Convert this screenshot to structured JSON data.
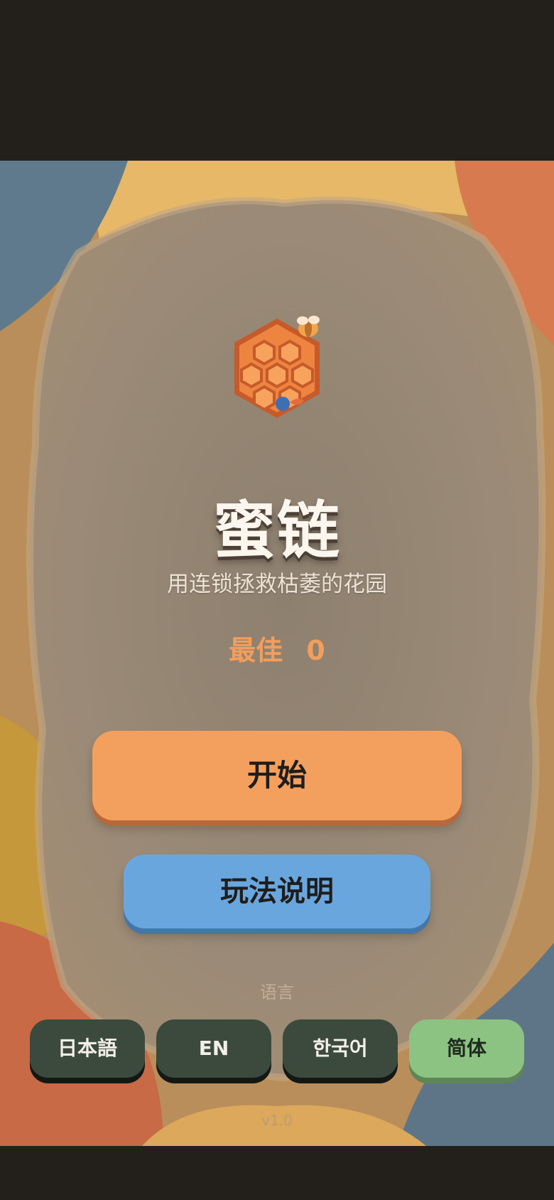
{
  "game": {
    "title": "蜜链",
    "subtitle": "用连锁拯救枯萎的花园",
    "best_label": "最佳",
    "best_value": "0",
    "start_label": "开始",
    "howto_label": "玩法说明",
    "language_label": "语言",
    "version": "v1.0"
  },
  "languages": [
    {
      "label": "日本語",
      "active": false
    },
    {
      "label": "EN",
      "active": false
    },
    {
      "label": "한국어",
      "active": false
    },
    {
      "label": "简体",
      "active": true
    }
  ],
  "colors": {
    "start_button": "#f3a05f",
    "howto_button": "#6aa6de",
    "lang_button": "#3b4a3d",
    "lang_button_active": "#8dc382",
    "best_score": "#f39e5c"
  },
  "icons": {
    "logo": "honeycomb-bee-icon"
  }
}
